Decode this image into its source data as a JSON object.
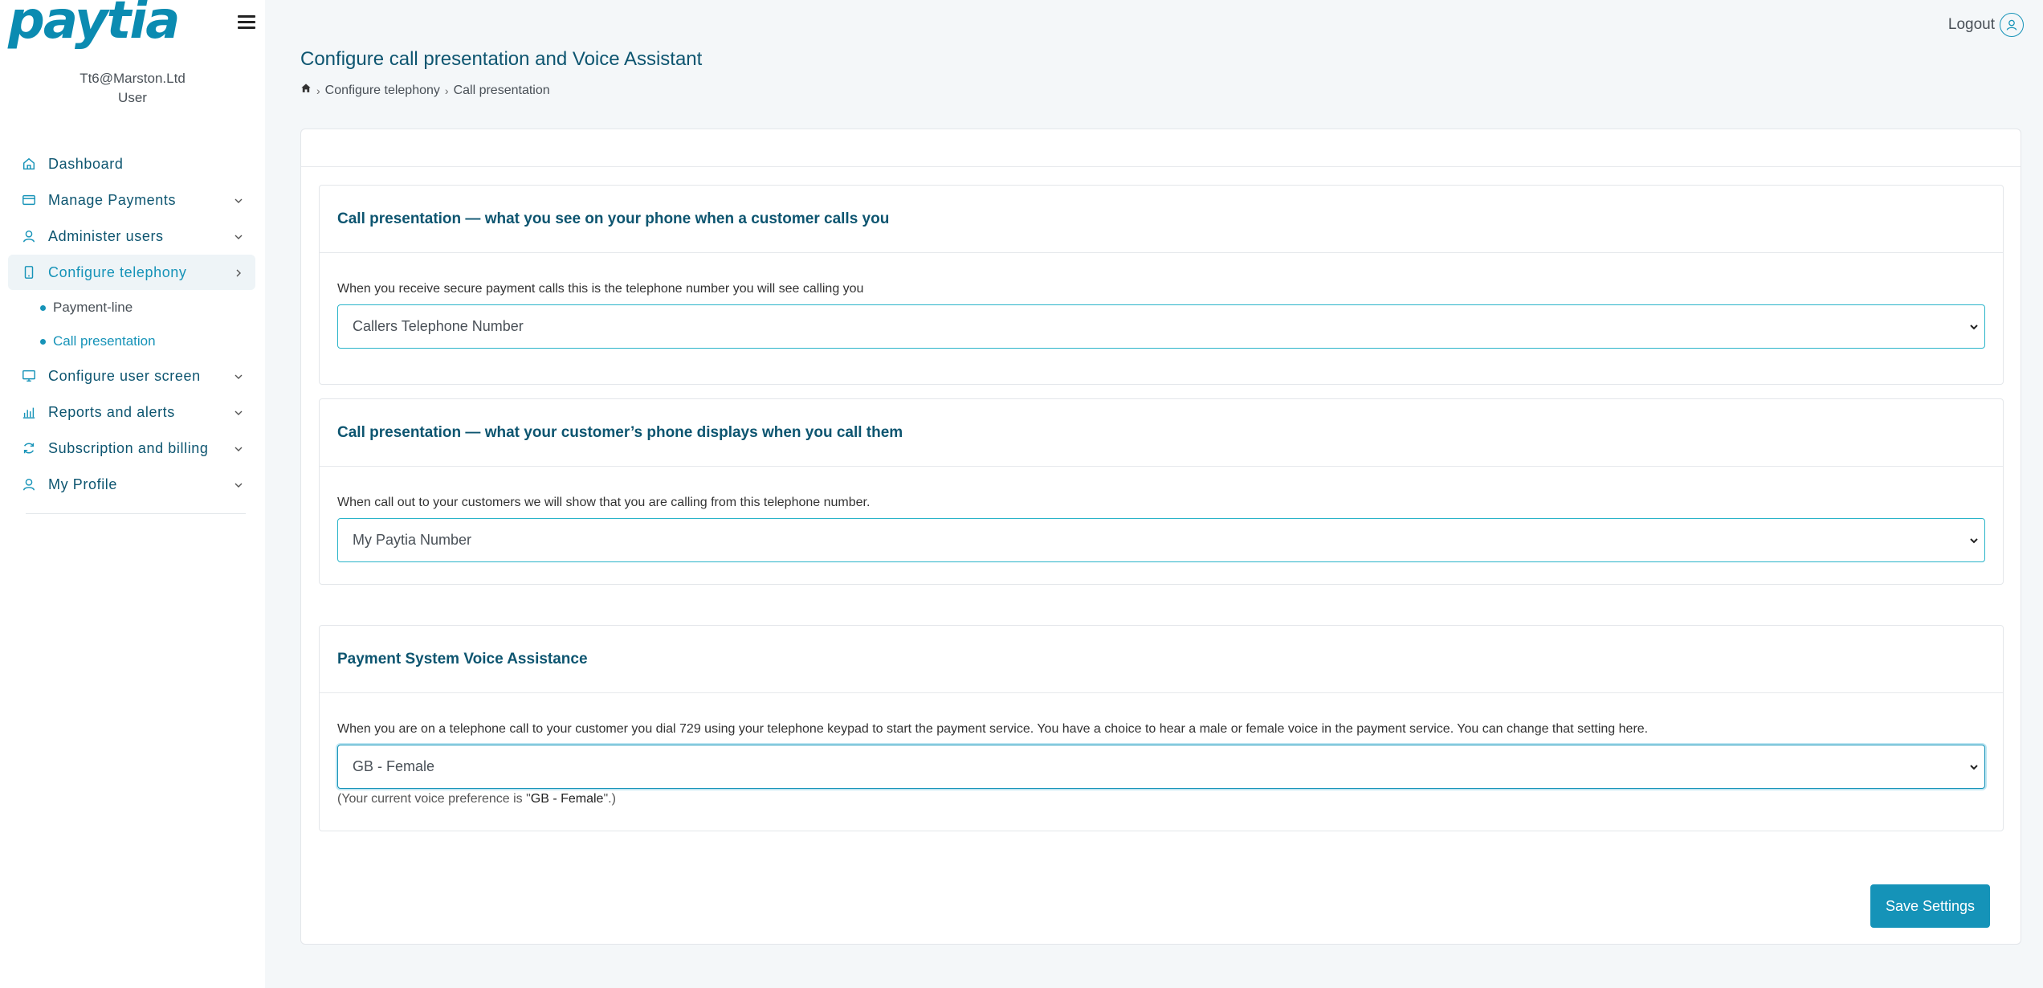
{
  "brand": {
    "logo_text": "paytia",
    "accent": "#1593b8",
    "title_color": "#0d5570"
  },
  "user": {
    "email": "Tt6@Marston.Ltd",
    "role": "User"
  },
  "header": {
    "logout_label": "Logout"
  },
  "nav": {
    "items": [
      {
        "label": "Dashboard",
        "icon": "home-icon"
      },
      {
        "label": "Manage Payments",
        "icon": "card-icon"
      },
      {
        "label": "Administer users",
        "icon": "user-icon"
      },
      {
        "label": "Configure telephony",
        "icon": "phone-icon"
      },
      {
        "label": "Configure user screen",
        "icon": "monitor-icon"
      },
      {
        "label": "Reports and alerts",
        "icon": "chart-icon"
      },
      {
        "label": "Subscription and billing",
        "icon": "refresh-icon"
      },
      {
        "label": "My Profile",
        "icon": "user-icon"
      }
    ],
    "sub_items": [
      {
        "label": "Payment-line"
      },
      {
        "label": "Call presentation"
      }
    ]
  },
  "page": {
    "title": "Configure call presentation and Voice Assistant",
    "breadcrumb": [
      "Configure telephony",
      "Call presentation"
    ]
  },
  "sections": [
    {
      "title": "Call presentation — what you see on your phone when a customer calls you",
      "description": "When you receive secure payment calls this is the telephone number you will see calling you",
      "selected": "Callers Telephone Number"
    },
    {
      "title": "Call presentation — what your customer’s phone displays when you call them",
      "description": "When call out to your customers we will show that you are calling from this telephone number.",
      "selected": "My Paytia Number"
    },
    {
      "title": "Payment System Voice Assistance",
      "description": "When you are on a telephone call to your customer you dial 729 using your telephone keypad to start the payment service. You have a choice to hear a male or female voice in the payment service. You can change that setting here.",
      "selected": "GB - Female",
      "current_prefix": "(Your current voice preference is \"",
      "current_value": "GB - Female",
      "current_suffix": "\".)"
    }
  ],
  "save_label": "Save Settings"
}
